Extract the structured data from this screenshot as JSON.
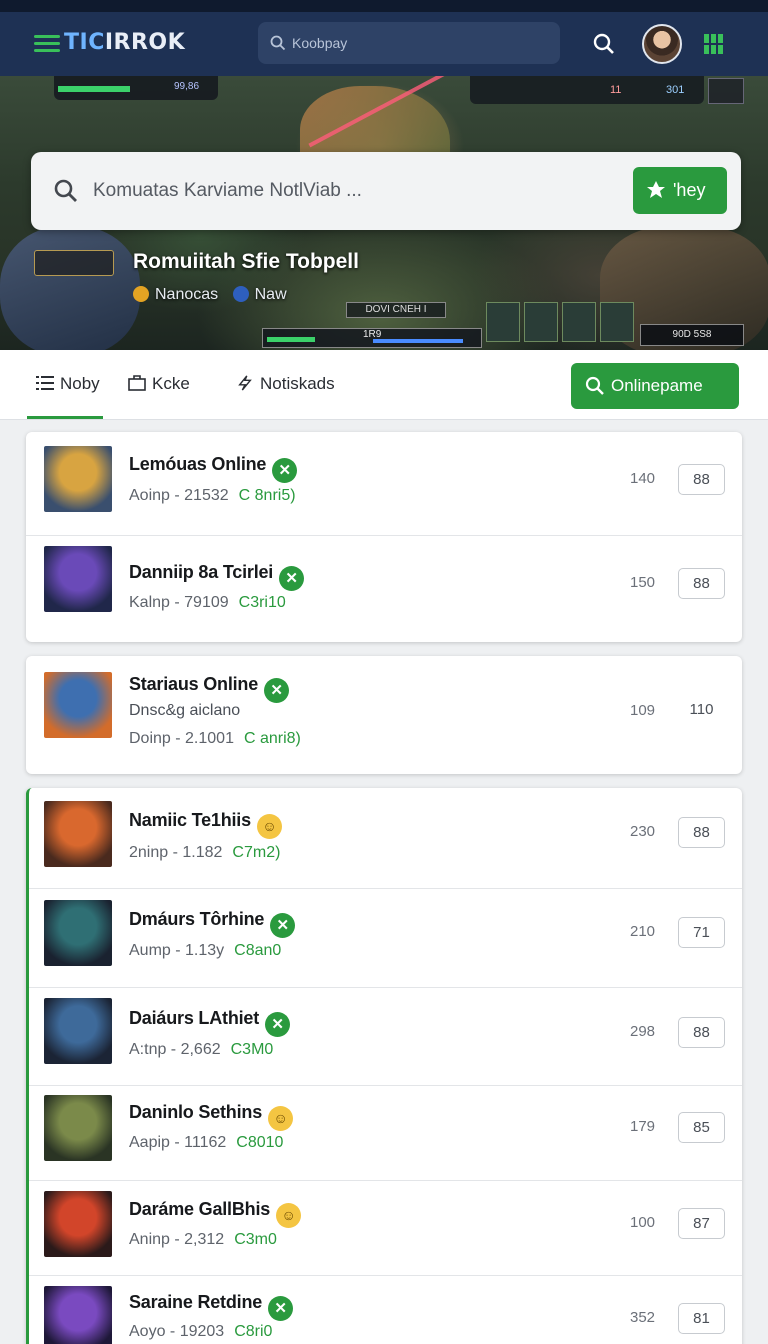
{
  "header": {
    "logo_prefix": "TIC",
    "logo_suffix": "IRROK",
    "search_placeholder": "Koobpay",
    "menu_icon": "hamburger-icon",
    "search_icon": "search-icon",
    "grid_icon": "grid-icon"
  },
  "hero": {
    "search_text": "Komuatas Karviame NotlViab ...",
    "search_button": "'hey",
    "title": "Romuiitah Sfie Tobpell",
    "meta_1": "Nanocas",
    "meta_2": "Naw",
    "hud_left_a": "",
    "hud_left_b": "99,86",
    "hud_right_a": "11",
    "hud_right_b": "301",
    "center_label": "DOVI CNEH I",
    "progress_label": "1R9",
    "corner_label": "90D 5S8"
  },
  "tabs": {
    "items": [
      {
        "label": "Noby",
        "icon": "list-icon"
      },
      {
        "label": "Kcke",
        "icon": "bag-icon"
      },
      {
        "label": "Notiskads",
        "icon": "lightning-icon"
      }
    ],
    "online_button": "Onlinepame"
  },
  "games": [
    {
      "name": "Lemóuas Online",
      "badge": "x",
      "sub": "Aoinp  - 21532",
      "tag": "C 8nri5)",
      "num": "140",
      "pill": "88",
      "colors": [
        "#d8a441",
        "#3a4f6e"
      ]
    },
    {
      "name": "Danniip 8a Tcirlei",
      "badge": "x",
      "sub": "Kalnp  - 79109",
      "tag": "C3ri10",
      "num": "150",
      "pill": "88",
      "colors": [
        "#6a4ab8",
        "#20274a"
      ]
    },
    {
      "name": "Stariaus Online",
      "badge": "x",
      "desc": "Dnsc&g aiclano",
      "sub": "Doinp  - 2.1001",
      "tag": "C anri8)",
      "num": "109",
      "pill": "110",
      "colors": [
        "#3e6fb0",
        "#d36c2a"
      ]
    },
    {
      "name": "Namiic Te1hiis",
      "badge": "smile",
      "sub": "2ninp  - 1.182",
      "tag": "C7m2)",
      "num": "230",
      "pill": "88",
      "colors": [
        "#d9682e",
        "#4a2a1e"
      ]
    },
    {
      "name": "Dmáurs Tôrhine",
      "badge": "x",
      "sub": "Aump  - 1.13y",
      "tag": "C8an0",
      "num": "210",
      "pill": "71",
      "colors": [
        "#2f6f74",
        "#1a2230"
      ]
    },
    {
      "name": "Daiáurs LAthiet",
      "badge": "x",
      "sub": "A:tnp  - 2,662",
      "tag": "C3M0",
      "num": "298",
      "pill": "88",
      "colors": [
        "#3e6a9a",
        "#1b2435"
      ]
    },
    {
      "name": "Daninlo Sethins",
      "badge": "smile",
      "sub": "Aapip  - 11162",
      "tag": "C8010",
      "num": "179",
      "pill": "85",
      "colors": [
        "#7b8a4a",
        "#2a3424"
      ]
    },
    {
      "name": "Daráme GallBhis",
      "badge": "smile",
      "sub": "Aninp  - 2,312",
      "tag": "C3m0",
      "num": "100",
      "pill": "87",
      "colors": [
        "#d2452a",
        "#2b1a1a"
      ]
    },
    {
      "name": "Saraine Retdine",
      "badge": "x",
      "sub": "Aoyo  - 19203",
      "tag": "C8ri0",
      "num": "352",
      "pill": "81",
      "colors": [
        "#7a4ac0",
        "#1e1838"
      ]
    }
  ]
}
